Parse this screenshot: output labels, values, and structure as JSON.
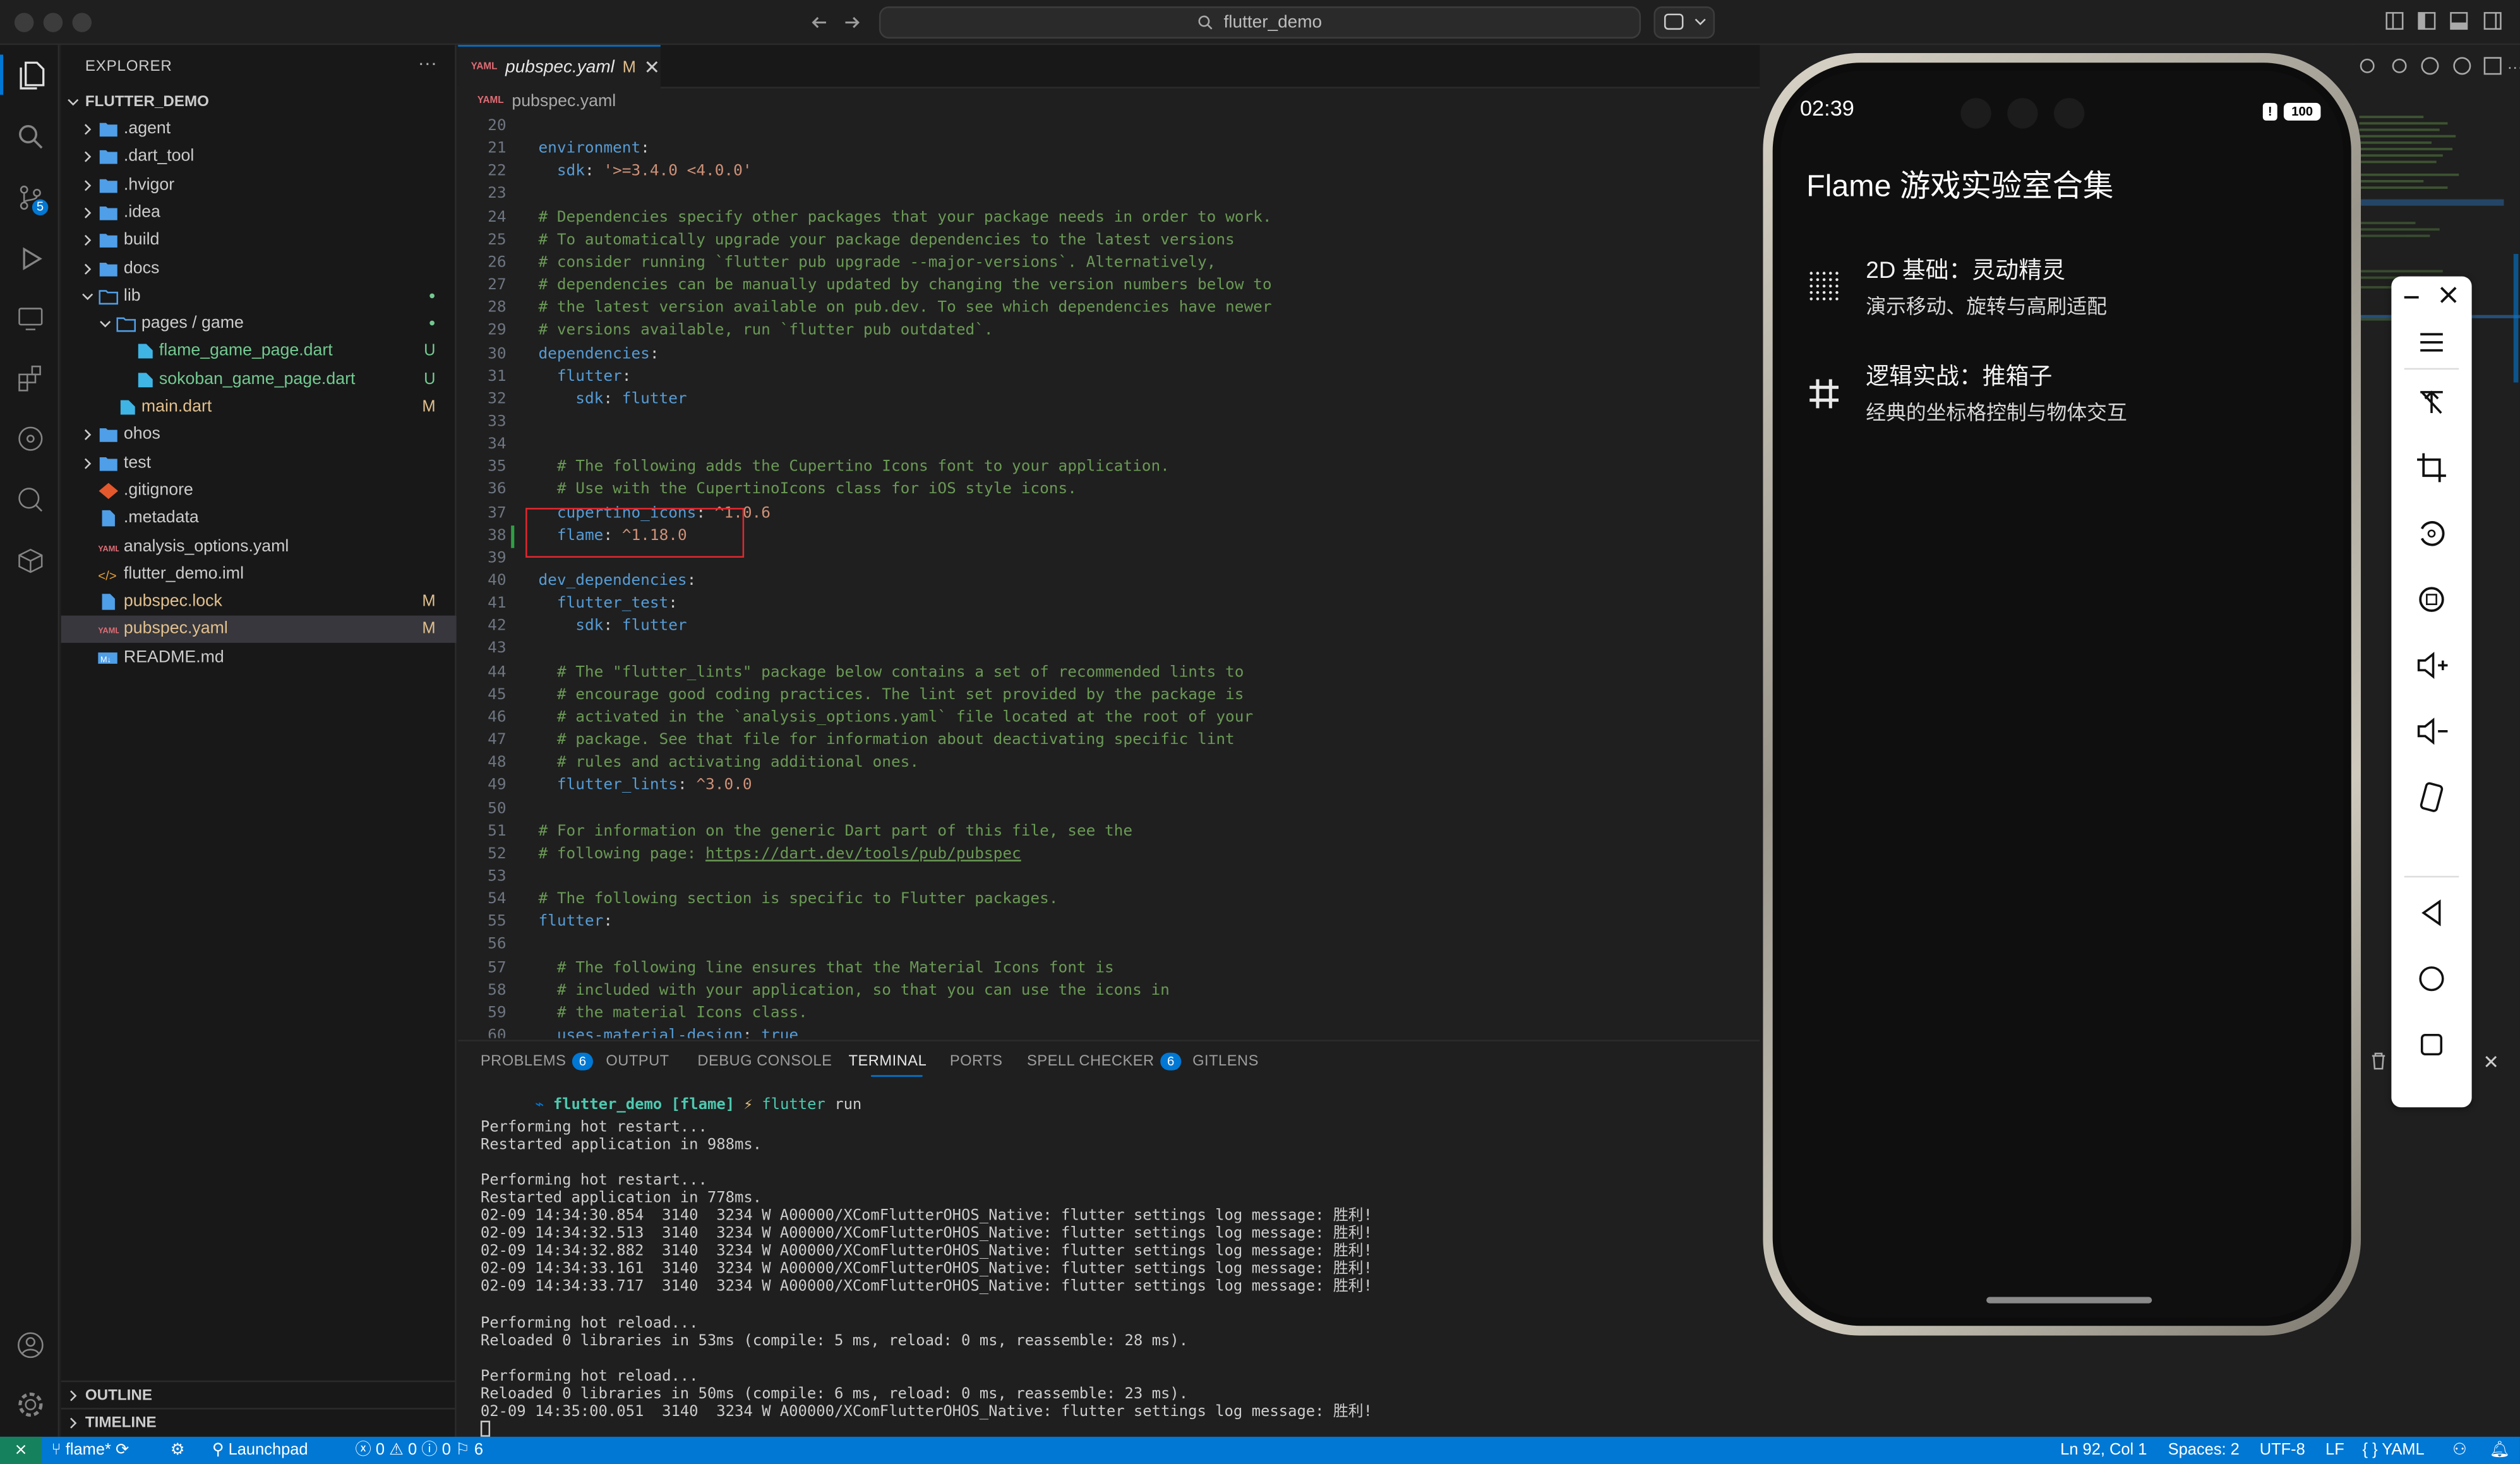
{
  "window": {
    "search_text": "flutter_demo"
  },
  "sidebar": {
    "title": "EXPLORER",
    "root": "FLUTTER_DEMO",
    "items": [
      {
        "name": ".agent",
        "type": "folder",
        "git": ""
      },
      {
        "name": ".dart_tool",
        "type": "folder",
        "git": ""
      },
      {
        "name": ".hvigor",
        "type": "folder",
        "git": ""
      },
      {
        "name": ".idea",
        "type": "folder",
        "git": ""
      },
      {
        "name": "build",
        "type": "folder",
        "git": ""
      },
      {
        "name": "docs",
        "type": "folder",
        "git": ""
      },
      {
        "name": "lib",
        "type": "folder-open",
        "git": ""
      },
      {
        "name": "pages / game",
        "type": "folder-open",
        "git": ""
      },
      {
        "name": "flame_game_page.dart",
        "type": "dart",
        "git": "U"
      },
      {
        "name": "sokoban_game_page.dart",
        "type": "dart",
        "git": "U"
      },
      {
        "name": "main.dart",
        "type": "dart",
        "git": "M"
      },
      {
        "name": "ohos",
        "type": "folder",
        "git": ""
      },
      {
        "name": "test",
        "type": "folder",
        "git": ""
      },
      {
        "name": ".gitignore",
        "type": "git",
        "git": ""
      },
      {
        "name": ".metadata",
        "type": "file",
        "git": ""
      },
      {
        "name": "analysis_options.yaml",
        "type": "yaml",
        "git": ""
      },
      {
        "name": "flutter_demo.iml",
        "type": "xml",
        "git": ""
      },
      {
        "name": "pubspec.lock",
        "type": "file",
        "git": "M"
      },
      {
        "name": "pubspec.yaml",
        "type": "yaml",
        "git": "M"
      },
      {
        "name": "README.md",
        "type": "md",
        "git": ""
      }
    ],
    "outline": "OUTLINE",
    "timeline": "TIMELINE",
    "scm_badge": "5"
  },
  "editor": {
    "tab_label": "pubspec.yaml",
    "tab_status": "M",
    "breadcrumb": "pubspec.yaml",
    "lines": [
      {
        "n": "20",
        "t": ""
      },
      {
        "n": "21",
        "t": "environment:"
      },
      {
        "n": "22",
        "t": "  sdk: '>=3.4.0 <4.0.0'"
      },
      {
        "n": "23",
        "t": ""
      },
      {
        "n": "24",
        "t": "# Dependencies specify other packages that your package needs in order to work."
      },
      {
        "n": "25",
        "t": "# To automatically upgrade your package dependencies to the latest versions"
      },
      {
        "n": "26",
        "t": "# consider running `flutter pub upgrade --major-versions`. Alternatively,"
      },
      {
        "n": "27",
        "t": "# dependencies can be manually updated by changing the version numbers below to"
      },
      {
        "n": "28",
        "t": "# the latest version available on pub.dev. To see which dependencies have newer"
      },
      {
        "n": "29",
        "t": "# versions available, run `flutter pub outdated`."
      },
      {
        "n": "30",
        "t": "dependencies:"
      },
      {
        "n": "31",
        "t": "  flutter:"
      },
      {
        "n": "32",
        "t": "    sdk: flutter"
      },
      {
        "n": "33",
        "t": ""
      },
      {
        "n": "34",
        "t": ""
      },
      {
        "n": "35",
        "t": "  # The following adds the Cupertino Icons font to your application."
      },
      {
        "n": "36",
        "t": "  # Use with the CupertinoIcons class for iOS style icons."
      },
      {
        "n": "37",
        "t": "  cupertino_icons: ^1.0.6"
      },
      {
        "n": "38",
        "t": "  flame: ^1.18.0"
      },
      {
        "n": "39",
        "t": ""
      },
      {
        "n": "40",
        "t": "dev_dependencies:"
      },
      {
        "n": "41",
        "t": "  flutter_test:"
      },
      {
        "n": "42",
        "t": "    sdk: flutter"
      },
      {
        "n": "43",
        "t": ""
      },
      {
        "n": "44",
        "t": "  # The \"flutter_lints\" package below contains a set of recommended lints to"
      },
      {
        "n": "45",
        "t": "  # encourage good coding practices. The lint set provided by the package is"
      },
      {
        "n": "46",
        "t": "  # activated in the `analysis_options.yaml` file located at the root of your"
      },
      {
        "n": "47",
        "t": "  # package. See that file for information about deactivating specific lint"
      },
      {
        "n": "48",
        "t": "  # rules and activating additional ones."
      },
      {
        "n": "49",
        "t": "  flutter_lints: ^3.0.0"
      },
      {
        "n": "50",
        "t": ""
      },
      {
        "n": "51",
        "t": "# For information on the generic Dart part of this file, see the"
      },
      {
        "n": "52",
        "t": "# following page: https://dart.dev/tools/pub/pubspec"
      },
      {
        "n": "53",
        "t": ""
      },
      {
        "n": "54",
        "t": "# The following section is specific to Flutter packages."
      },
      {
        "n": "55",
        "t": "flutter:"
      },
      {
        "n": "56",
        "t": ""
      },
      {
        "n": "57",
        "t": "  # The following line ensures that the Material Icons font is"
      },
      {
        "n": "58",
        "t": "  # included with your application, so that you can use the icons in"
      },
      {
        "n": "59",
        "t": "  # the material Icons class."
      },
      {
        "n": "60",
        "t": "  uses-material-design: true"
      }
    ]
  },
  "panel": {
    "tabs": [
      {
        "label": "PROBLEMS",
        "badge": "6"
      },
      {
        "label": "OUTPUT",
        "badge": ""
      },
      {
        "label": "DEBUG CONSOLE",
        "badge": ""
      },
      {
        "label": "TERMINAL",
        "badge": ""
      },
      {
        "label": "PORTS",
        "badge": ""
      },
      {
        "label": "SPELL CHECKER",
        "badge": "6"
      },
      {
        "label": "GITLENS",
        "badge": ""
      }
    ],
    "prompt_dir": "flutter_demo [flame]",
    "prompt_symbol": "⚡",
    "prompt_cmd": "flutter",
    "prompt_arg": "run",
    "terminal_lines": [
      "Performing hot restart...",
      "Restarted application in 988ms.",
      "",
      "Performing hot restart...",
      "Restarted application in 778ms.",
      "02-09 14:34:30.854  3140  3234 W A00000/XComFlutterOHOS_Native: flutter settings log message: 胜利!",
      "02-09 14:34:32.513  3140  3234 W A00000/XComFlutterOHOS_Native: flutter settings log message: 胜利!",
      "02-09 14:34:32.882  3140  3234 W A00000/XComFlutterOHOS_Native: flutter settings log message: 胜利!",
      "02-09 14:34:33.161  3140  3234 W A00000/XComFlutterOHOS_Native: flutter settings log message: 胜利!",
      "02-09 14:34:33.717  3140  3234 W A00000/XComFlutterOHOS_Native: flutter settings log message: 胜利!",
      "",
      "Performing hot reload...",
      "Reloaded 0 libraries in 53ms (compile: 5 ms, reload: 0 ms, reassemble: 28 ms).",
      "",
      "Performing hot reload...",
      "Reloaded 0 libraries in 50ms (compile: 6 ms, reload: 0 ms, reassemble: 23 ms).",
      "02-09 14:35:00.051  3140  3234 W A00000/XComFlutterOHOS_Native: flutter settings log message: 胜利!"
    ]
  },
  "status": {
    "branch": "flame*",
    "launchpad": "Launchpad",
    "errors": "0",
    "warnings": "0",
    "info": "0",
    "other": "6",
    "position": "Ln 92, Col 1",
    "spaces": "Spaces: 2",
    "encoding": "UTF-8",
    "eol": "LF",
    "language": "YAML"
  },
  "phone": {
    "time": "02:39",
    "battery": "100",
    "app_title": "Flame 游戏实验室合集",
    "items": [
      {
        "title": "2D 基础：灵动精灵",
        "subtitle": "演示移动、旋转与高刷适配",
        "icon": "grid-dots-icon"
      },
      {
        "title": "逻辑实战：推箱子",
        "subtitle": "经典的坐标格控制与物体交互",
        "icon": "hash-grid-icon"
      }
    ]
  },
  "colors": {
    "accent": "#0078d4",
    "git_modified": "#e2c08d",
    "git_untracked": "#73c991",
    "folder": "#4f9ee8"
  }
}
